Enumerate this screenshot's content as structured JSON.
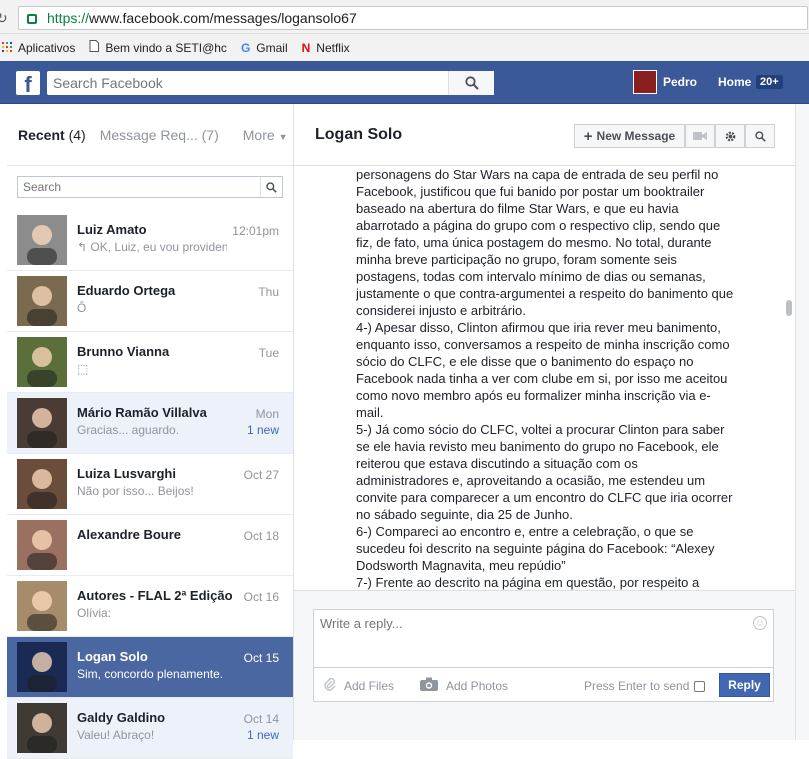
{
  "browser": {
    "url_scheme": "https://",
    "url_rest": "www.facebook.com/messages/logansolo67",
    "bookmarks": [
      {
        "label": "Aplicativos",
        "icon": "apps-grid-icon"
      },
      {
        "label": "Bem vindo a SETI@hc",
        "icon": "page-icon"
      },
      {
        "label": "Gmail",
        "icon": "google-g-icon"
      },
      {
        "label": "Netflix",
        "icon": "netflix-n-icon"
      }
    ]
  },
  "header": {
    "logo": "f",
    "search_placeholder": "Search Facebook",
    "user_name": "Pedro",
    "home_label": "Home",
    "home_badge": "20+"
  },
  "left": {
    "tab_recent": "Recent",
    "tab_recent_count": "(4)",
    "tab_requests": "Message Req... (7)",
    "tab_more": "More",
    "search_placeholder": "Search",
    "conversations": [
      {
        "name": "Luiz Amato",
        "preview": "↰ OK, Luiz, eu vou providen...",
        "time": "12:01pm",
        "new": "",
        "state": "read",
        "color": "#8c8c8c"
      },
      {
        "name": "Eduardo Ortega",
        "preview": "Ô",
        "time": "Thu",
        "new": "",
        "state": "read",
        "color": "#7a6a4f"
      },
      {
        "name": "Brunno Vianna",
        "preview": "⬚",
        "time": "Tue",
        "new": "",
        "state": "read",
        "color": "#5b6f3a"
      },
      {
        "name": "Mário Ramão Villalva",
        "preview": "Gracias... aguardo.",
        "time": "Mon",
        "new": "1 new",
        "state": "unread",
        "color": "#4a3c35"
      },
      {
        "name": "Luiza Lusvarghi",
        "preview": "Não por isso... Beijos!",
        "time": "Oct 27",
        "new": "",
        "state": "read",
        "color": "#6b4d3c"
      },
      {
        "name": "Alexandre Boure",
        "preview": "",
        "time": "Oct 18",
        "new": "",
        "state": "read",
        "color": "#9a7060"
      },
      {
        "name": "Autores - FLAL 2ª Edição",
        "preview": "Olívia:",
        "time": "Oct 16",
        "new": "",
        "state": "read",
        "color": "#a78c6c"
      },
      {
        "name": "Logan Solo",
        "preview": "Sim, concordo plenamente.",
        "time": "Oct 15",
        "new": "",
        "state": "selected",
        "color": "#1a2a55"
      },
      {
        "name": "Galdy Galdino",
        "preview": "Valeu! Abraço!",
        "time": "Oct 14",
        "new": "1 new",
        "state": "unread",
        "color": "#3f3a33"
      }
    ]
  },
  "thread": {
    "title": "Logan Solo",
    "new_message_label": "New Message",
    "message_lines": [
      "personagens do Star Wars na capa de entrada de seu perfil no",
      "Facebook, justificou que fui banido por postar um booktrailer",
      "baseado na abertura do filme Star Wars, e que eu havia",
      "abarrotado a página do grupo com o respectivo clip, sendo que",
      "fiz, de fato, uma única postagem do mesmo. No total, durante",
      "minha breve participação no grupo, foram somente seis",
      "postagens, todas com intervalo mínimo de dias ou semanas,",
      "justamente o que contra-argumentei a respeito do banimento que",
      "considerei injusto e arbitrário.",
      "4-) Apesar disso, Clinton afirmou que iria rever meu banimento,",
      "enquanto isso, conversamos a respeito de minha inscrição como",
      "sócio do CLFC, e ele disse que o banimento do espaço no",
      "Facebook nada tinha a ver com clube em si, por isso me aceitou",
      "como novo membro após eu formalizer minha inscrição via e-",
      "mail.",
      "5-) Já como sócio do CLFC, voltei a procurar Clinton para saber",
      "se ele havia revisto meu banimento do grupo no Facebook, ele",
      "reiterou que estava discutindo a situação com os",
      "administradores e, aproveitando a ocasião, me estendeu um",
      "convite para comparecer a um encontro do CLFC que iria ocorrer",
      "no sábado seguinte, dia 25 de Junho.",
      "6-) Compareci ao encontro e, entre a celebração, o que se",
      "sucedeu foi descrito na seguinte página do Facebook: “Alexey",
      "Dodsworth Magnavita, meu repúdio”",
      "7-) Frente ao descrito na página em questão, por respeito a"
    ],
    "reply_placeholder": "Write a reply...",
    "add_files_label": "Add Files",
    "add_photos_label": "Add Photos",
    "press_enter_label": "Press Enter to send",
    "reply_button_label": "Reply"
  },
  "colors": {
    "fb_blue": "#3b5998",
    "selected_row": "#4b67a1",
    "link_blue": "#4267b2"
  }
}
